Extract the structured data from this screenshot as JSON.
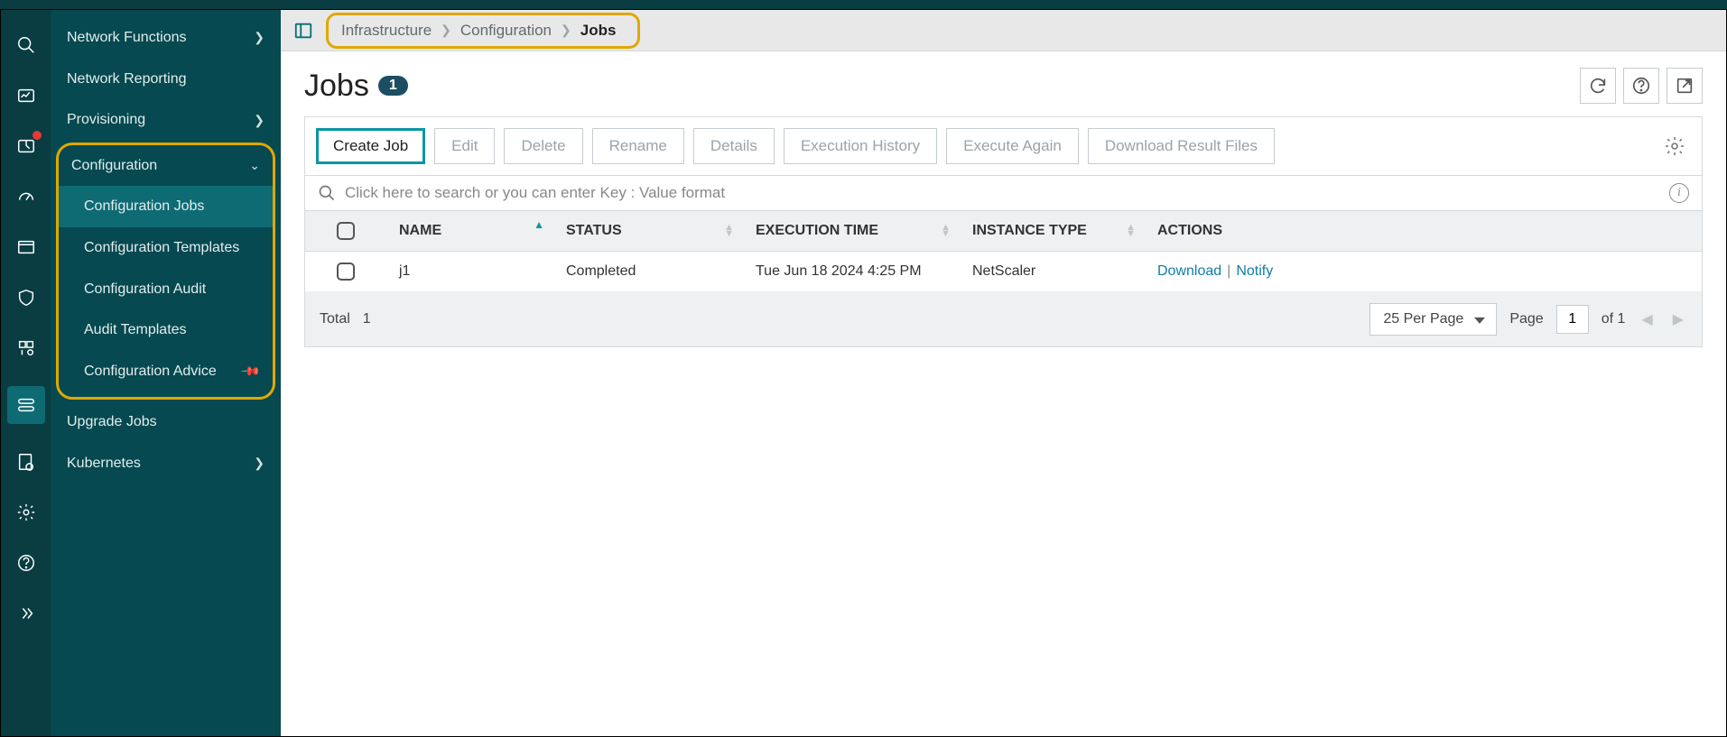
{
  "rail": {
    "items": [
      "search",
      "dashboard",
      "inbox",
      "gauge",
      "calendar",
      "shield",
      "apps",
      "storage",
      "report",
      "settings",
      "help",
      "expand"
    ]
  },
  "sidebar": {
    "items": [
      {
        "label": "Network Functions",
        "expandable": true
      },
      {
        "label": "Network Reporting",
        "expandable": false
      },
      {
        "label": "Provisioning",
        "expandable": true
      }
    ],
    "config": {
      "label": "Configuration",
      "children": [
        {
          "label": "Configuration Jobs"
        },
        {
          "label": "Configuration Templates"
        },
        {
          "label": "Configuration Audit"
        },
        {
          "label": "Audit Templates"
        },
        {
          "label": "Configuration Advice"
        }
      ]
    },
    "upgrade_label": "Upgrade Jobs",
    "kubernetes_label": "Kubernetes"
  },
  "breadcrumb": {
    "items": [
      "Infrastructure",
      "Configuration",
      "Jobs"
    ]
  },
  "page": {
    "title": "Jobs",
    "count": "1"
  },
  "toolbar": {
    "create": "Create Job",
    "edit": "Edit",
    "delete": "Delete",
    "rename": "Rename",
    "details": "Details",
    "history": "Execution History",
    "execute": "Execute Again",
    "download": "Download Result Files"
  },
  "search": {
    "placeholder": "Click here to search or you can enter Key : Value format"
  },
  "table": {
    "headers": {
      "name": "NAME",
      "status": "STATUS",
      "exec": "EXECUTION TIME",
      "inst": "INSTANCE TYPE",
      "actions": "ACTIONS"
    },
    "rows": [
      {
        "name": "j1",
        "status": "Completed",
        "exec": "Tue Jun 18 2024 4:25 PM",
        "inst": "NetScaler",
        "act_download": "Download",
        "act_notify": "Notify"
      }
    ]
  },
  "footer": {
    "total_label": "Total",
    "total_value": "1",
    "perpage": "25 Per Page",
    "page_label": "Page",
    "page_value": "1",
    "of_label": "of 1"
  }
}
